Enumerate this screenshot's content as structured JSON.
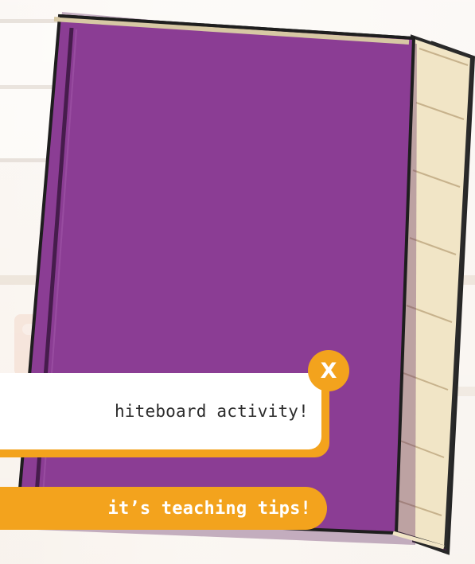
{
  "popup": {
    "message": "hiteboard activity!",
    "close_label": "X"
  },
  "footer": {
    "tips_label": "it’s teaching tips!"
  },
  "colors": {
    "book_cover": "#8b3d94",
    "book_pages": "#f3e4c3",
    "accent": "#f3a31d",
    "text": "#2c2c2c",
    "background": "#f6efe6"
  }
}
